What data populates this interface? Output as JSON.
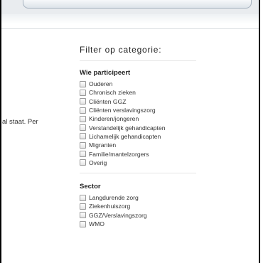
{
  "left_text": "al staat. Per",
  "filter": {
    "title": "Filter op categorie:",
    "sections": [
      {
        "title": "Wie participeert",
        "items": [
          "Ouderen",
          "Chronisch zieken",
          "Cliënten GGZ",
          "Cliënten verslavingszorg",
          "Kinderen/jongeren",
          "Verstandelijk gehandicapten",
          "Lichamelijk gehandicapten",
          "Migranten",
          "Familie/mantelzorgers",
          "Overig"
        ]
      },
      {
        "title": "Sector",
        "items": [
          "Langdurende zorg",
          "Ziekenhuiszorg",
          "GGZ/Verslavingszorg",
          "WMO"
        ]
      }
    ]
  }
}
